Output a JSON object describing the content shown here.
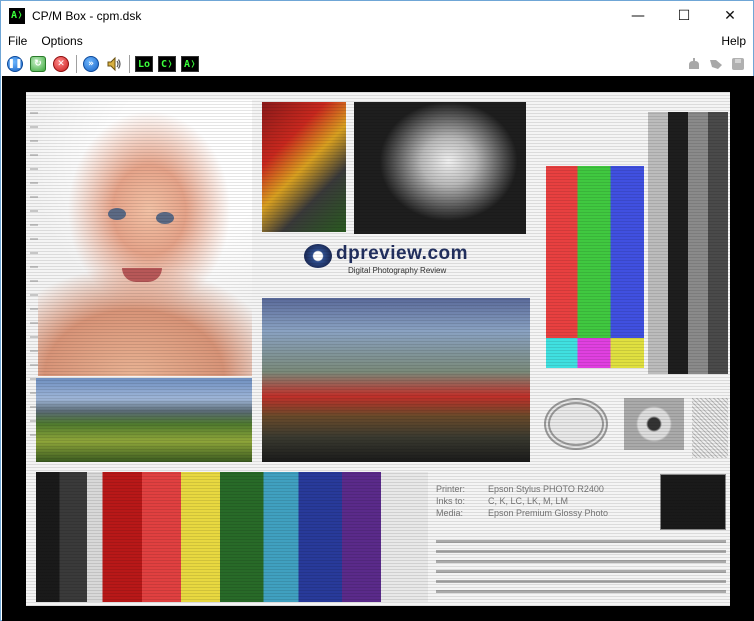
{
  "window": {
    "title": "CP/M Box - cpm.dsk",
    "app_icon_label": "A❭",
    "controls": {
      "minimize": "—",
      "maximize": "☐",
      "close": "✕"
    }
  },
  "menubar": {
    "items": [
      "File",
      "Options"
    ],
    "help": "Help"
  },
  "toolbar": {
    "pause_icon": "pause-icon",
    "reset_icon": "reset-icon",
    "stop_icon": "stop-icon",
    "fast_forward_icon": "fast-forward-icon",
    "sound_icon": "speaker-icon",
    "terminal_buttons": [
      "Lo",
      "C❭",
      "A❭"
    ],
    "right_icons": [
      "mouse-icon",
      "cursor-icon",
      "disk-icon"
    ]
  },
  "screen": {
    "logo_text": "dpreview.com",
    "logo_subtitle": "Digital Photography Review",
    "info_labels": [
      "Printer:",
      "Inks to:",
      "Media:"
    ],
    "info_values": [
      "Epson Stylus PHOTO R2400",
      "C, K, LC, LK, M, LM",
      "Epson Premium Glossy Photo"
    ]
  },
  "colors": {
    "titlebar_bg": "#ffffff",
    "window_border": "#6fa6d6",
    "screen_bg": "#000000",
    "terminal_green": "#3bff3b"
  }
}
